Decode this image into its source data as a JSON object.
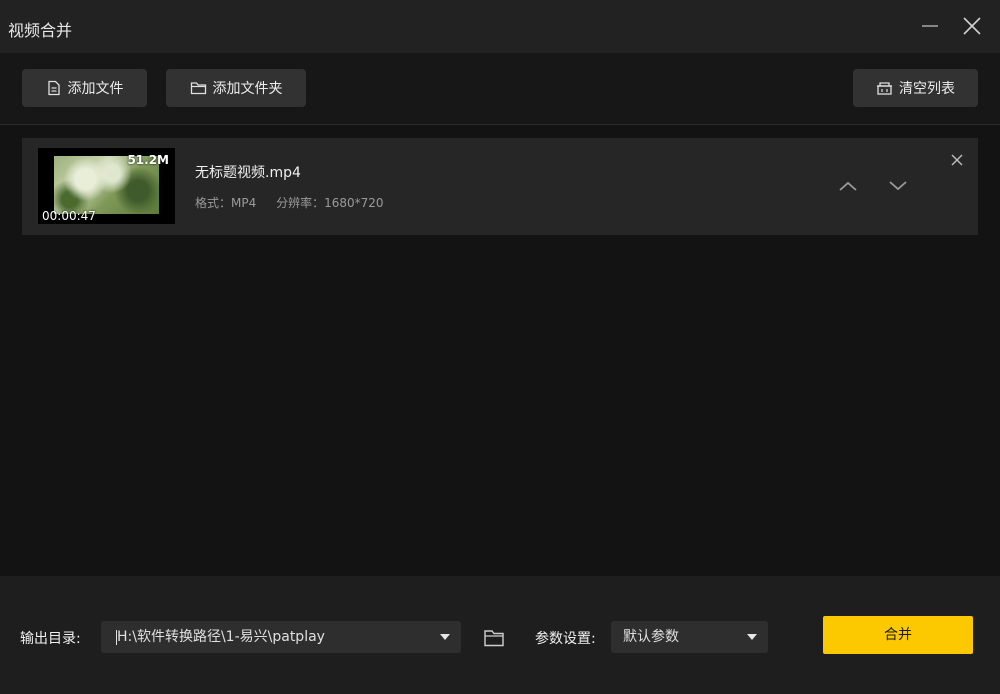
{
  "window": {
    "title": "视频合并"
  },
  "toolbar": {
    "add_file": "添加文件",
    "add_folder": "添加文件夹",
    "clear_list": "清空列表"
  },
  "files": [
    {
      "name": "无标题视频.mp4",
      "size": "51.2M",
      "duration": "00:00:47",
      "format": "格式：MP4",
      "resolution": "分辨率：1680*720"
    }
  ],
  "bottom": {
    "output_label": "输出目录:",
    "output_path": "H:\\软件转换路径\\1-易兴\\patplay",
    "param_label": "参数设置:",
    "param_value": "默认参数",
    "merge_label": "合并"
  },
  "colors": {
    "accent": "#fcc800",
    "background": "#131313",
    "panel": "#262626"
  },
  "icons": [
    "minimize-icon",
    "close-icon",
    "file-icon",
    "folder-icon",
    "basket-icon",
    "chevron-up-icon",
    "chevron-down-icon",
    "dropdown-arrow-icon"
  ]
}
